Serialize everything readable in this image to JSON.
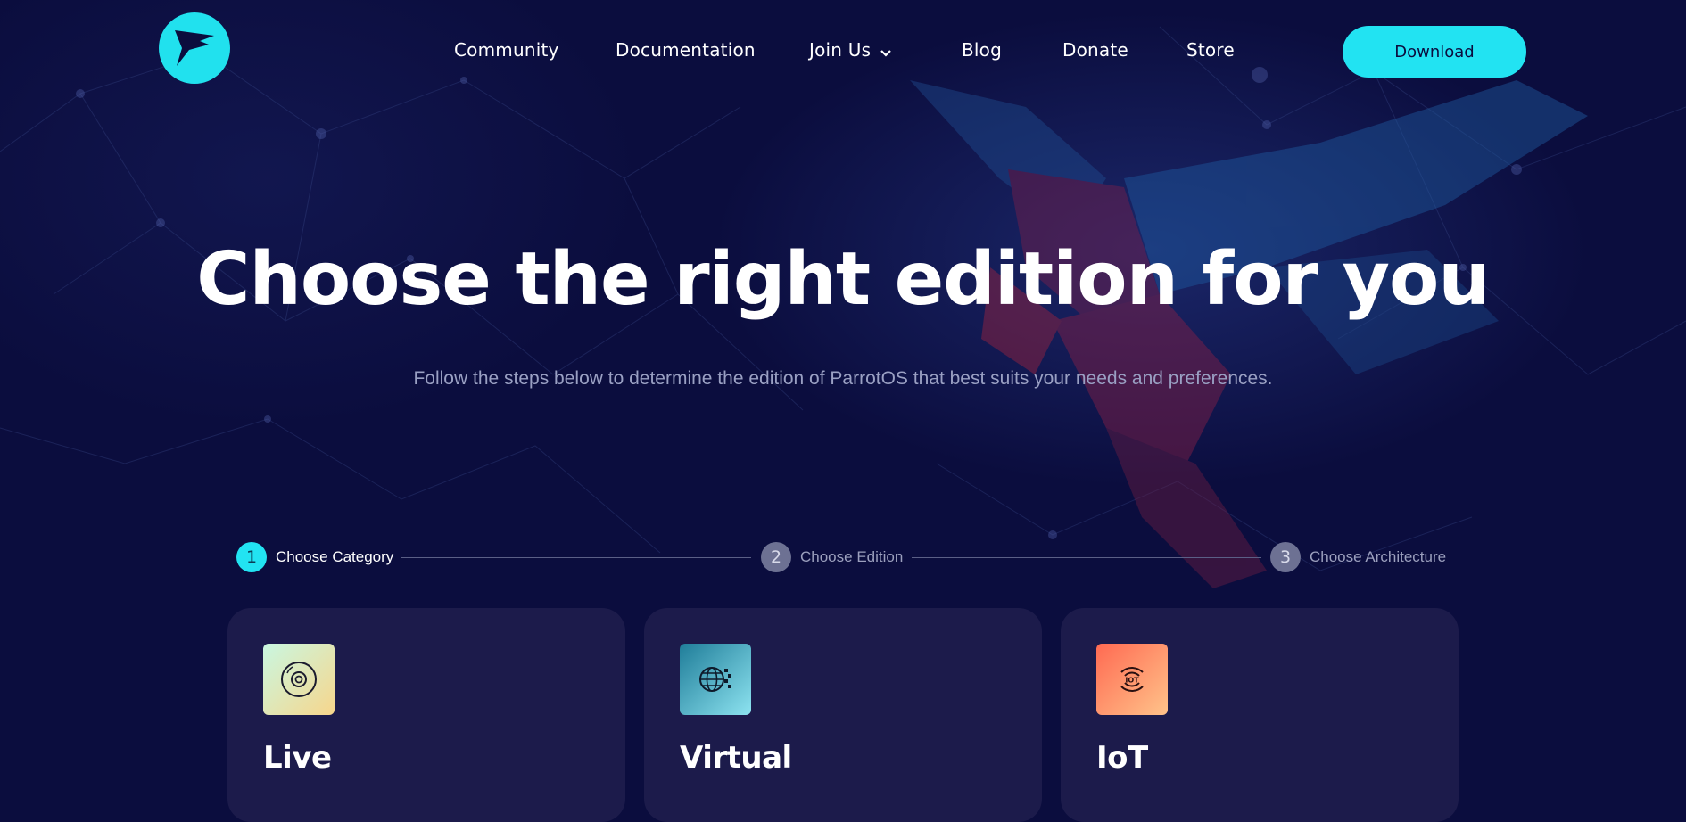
{
  "nav": {
    "items": [
      {
        "label": "Community"
      },
      {
        "label": "Documentation"
      },
      {
        "label": "Join Us"
      },
      {
        "label": "Blog"
      },
      {
        "label": "Donate"
      },
      {
        "label": "Store"
      }
    ],
    "download_label": "Download"
  },
  "hero": {
    "title": "Choose the right edition for you",
    "subtitle": "Follow the steps below to determine the edition of ParrotOS that best suits your needs and preferences."
  },
  "steps": [
    {
      "number": "1",
      "label": "Choose Category",
      "state": "active"
    },
    {
      "number": "2",
      "label": "Choose Edition",
      "state": "inactive"
    },
    {
      "number": "3",
      "label": "Choose Architecture",
      "state": "inactive"
    }
  ],
  "cards": [
    {
      "title": "Live",
      "icon": "disc-icon"
    },
    {
      "title": "Virtual",
      "icon": "globe-icon"
    },
    {
      "title": "IoT",
      "icon": "iot-icon"
    }
  ],
  "colors": {
    "background": "#0b0d3e",
    "accent": "#22e3f2",
    "card": "#1c1b4b",
    "muted_text": "#9aa0c3"
  }
}
